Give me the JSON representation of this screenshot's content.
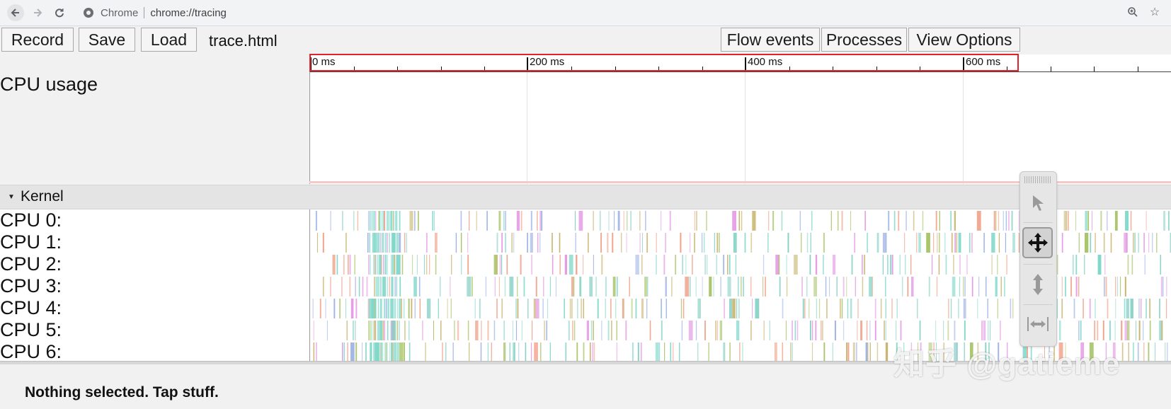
{
  "browser": {
    "site": "Chrome",
    "url": "chrome://tracing"
  },
  "toolbar": {
    "record_label": "Record",
    "save_label": "Save",
    "load_label": "Load",
    "filename": "trace.html",
    "flow_events_label": "Flow events",
    "processes_label": "Processes",
    "view_options_label": "View Options"
  },
  "ruler": {
    "labels": [
      "0 ms",
      "200 ms",
      "400 ms",
      "600 ms"
    ]
  },
  "tracks": {
    "cpu_usage_label": "CPU usage",
    "kernel_label": "Kernel",
    "cpu_rows": [
      "CPU 0:",
      "CPU 1:",
      "CPU 2:",
      "CPU 3:",
      "CPU 4:",
      "CPU 5:",
      "CPU 6:"
    ],
    "slice_colors": [
      "#c8b46e",
      "#86d0c4",
      "#a9c46a",
      "#e49be3",
      "#9fb3e6",
      "#f0a28a",
      "#7fd7c9"
    ]
  },
  "mouse_mode": {
    "modes": [
      "selection-icon",
      "pan-icon",
      "zoom-icon",
      "timing-icon"
    ],
    "active": "pan-icon"
  },
  "status": {
    "text": "Nothing selected. Tap stuff."
  },
  "watermark": {
    "text": "知乎 @gatieme"
  }
}
